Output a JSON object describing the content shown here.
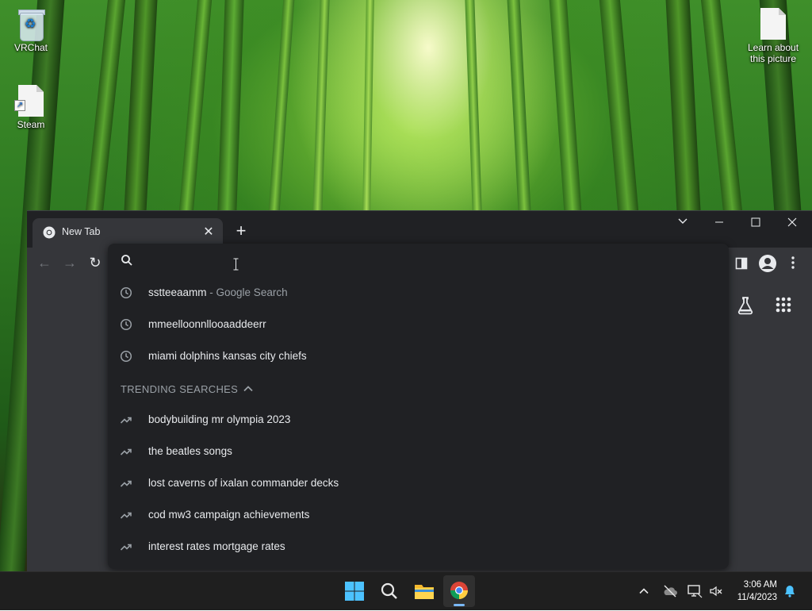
{
  "desktop": {
    "icons": [
      {
        "label": "VRChat"
      },
      {
        "label": "Steam"
      },
      {
        "label": "Learn about this picture"
      }
    ]
  },
  "browser": {
    "tab": {
      "title": "New Tab",
      "close": "✕"
    },
    "new_tab": "+",
    "window_controls": {
      "dropdown": "⌄",
      "minimize": "—",
      "maximize": "☐",
      "close": "✕"
    },
    "nav": {
      "back": "←",
      "forward": "→",
      "reload": "↻"
    }
  },
  "omnibox": {
    "value": "",
    "history": [
      {
        "text": "sstteeaamm",
        "suffix": " - Google Search",
        "icon": "history-clock-icon"
      },
      {
        "text": "mmeelloonnllooaaddeerr",
        "suffix": "",
        "icon": "history-clock-icon"
      },
      {
        "text": "miami dolphins kansas city chiefs",
        "suffix": "",
        "icon": "history-clock-icon"
      }
    ],
    "trending_header": "TRENDING SEARCHES",
    "trending": [
      {
        "text": "bodybuilding mr olympia 2023",
        "icon": "trending-icon"
      },
      {
        "text": "the beatles songs",
        "icon": "trending-icon"
      },
      {
        "text": "lost caverns of ixalan commander decks",
        "icon": "trending-icon"
      },
      {
        "text": "cod mw3 campaign achievements",
        "icon": "trending-icon"
      },
      {
        "text": "interest rates mortgage rates",
        "icon": "trending-icon"
      }
    ]
  },
  "taskbar": {
    "apps": [
      "start-button",
      "search",
      "file-explorer",
      "chrome"
    ],
    "clock": {
      "time": "3:06 AM",
      "date": "11/4/2023"
    }
  },
  "colors": {
    "omnibox_bg": "#202124",
    "toolbar_bg": "#35363a",
    "taskbar_bg": "#1f1f1f",
    "accent_blue": "#7ab8f5"
  }
}
